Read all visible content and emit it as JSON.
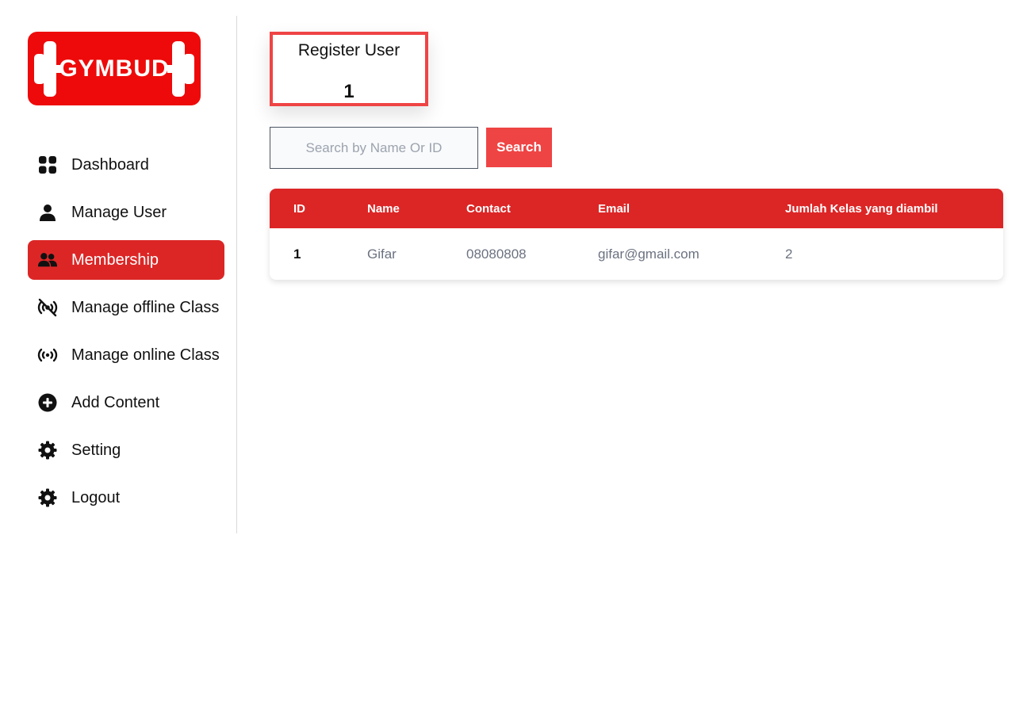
{
  "brand": {
    "logo_text": "GYMBUD",
    "color": "#ee0a0a"
  },
  "sidebar": {
    "items": [
      {
        "label": "Dashboard",
        "icon": "grid-icon",
        "active": false
      },
      {
        "label": "Manage User",
        "icon": "user-icon",
        "active": false
      },
      {
        "label": "Membership",
        "icon": "users-icon",
        "active": true
      },
      {
        "label": "Manage offline Class",
        "icon": "broadcast-off-icon",
        "active": false
      },
      {
        "label": "Manage online Class",
        "icon": "broadcast-icon",
        "active": false
      },
      {
        "label": "Add Content",
        "icon": "plus-circle-icon",
        "active": false
      },
      {
        "label": "Setting",
        "icon": "gear-icon",
        "active": false
      },
      {
        "label": "Logout",
        "icon": "gear-icon",
        "active": false
      }
    ]
  },
  "stat": {
    "title": "Register User",
    "value": "1"
  },
  "search": {
    "placeholder": "Search by Name Or ID",
    "value": "",
    "button_label": "Search"
  },
  "table": {
    "columns": [
      "ID",
      "Name",
      "Contact",
      "Email",
      "Jumlah Kelas yang diambil"
    ],
    "rows": [
      {
        "id": "1",
        "name": "Gifar",
        "contact": "08080808",
        "email": "gifar@gmail.com",
        "classes": "2"
      }
    ]
  },
  "colors": {
    "accent": "#dc2626",
    "accent_light": "#ef4444"
  }
}
